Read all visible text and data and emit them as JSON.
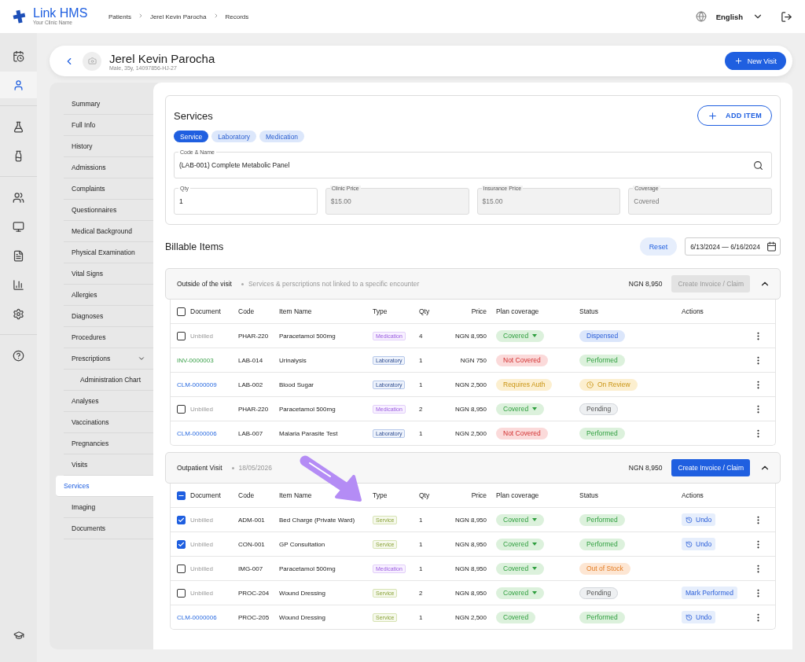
{
  "brand": {
    "name": "Link HMS",
    "subtitle": "Your Clinic Name"
  },
  "breadcrumbs": [
    "Patients",
    "Jerel Kevin Parocha",
    "Records"
  ],
  "language": "English",
  "rail": [
    {
      "kind": "calendar",
      "selected": false
    },
    {
      "kind": "patient",
      "selected": true
    },
    {
      "kind": "lab",
      "selected": false
    },
    {
      "kind": "bottle",
      "selected": false
    },
    {
      "kind": "people",
      "selected": false
    },
    {
      "kind": "monitor",
      "selected": false
    },
    {
      "kind": "document",
      "selected": false
    },
    {
      "kind": "chart",
      "selected": false
    },
    {
      "kind": "settings",
      "selected": false
    },
    {
      "kind": "help",
      "selected": false
    }
  ],
  "rail_footer": {
    "kind": "learning"
  },
  "patient": {
    "name": "Jerel Kevin Parocha",
    "details": "Male, 35y, 14097856-HJ-27",
    "new_visit": "New Visit"
  },
  "nav": [
    {
      "label": "Summary",
      "selected": false
    },
    {
      "label": "Full Info",
      "selected": false
    },
    {
      "label": "History",
      "selected": false
    },
    {
      "label": "Admissions",
      "selected": false
    },
    {
      "label": "Complaints",
      "selected": false
    },
    {
      "label": "Questionnaires",
      "selected": false
    },
    {
      "label": "Medical Background",
      "selected": false
    },
    {
      "label": "Physical Examination",
      "selected": false
    },
    {
      "label": "Vital Signs",
      "selected": false
    },
    {
      "label": "Allergies",
      "selected": false
    },
    {
      "label": "Diagnoses",
      "selected": false
    },
    {
      "label": "Procedures",
      "selected": false
    },
    {
      "label": "Prescriptions",
      "selected": false,
      "expanded": true,
      "children": [
        {
          "label": "Administration Chart",
          "selected": false
        }
      ]
    },
    {
      "label": "Analyses",
      "selected": false
    },
    {
      "label": "Vaccinations",
      "selected": false
    },
    {
      "label": "Pregnancies",
      "selected": false
    },
    {
      "label": "Visits",
      "selected": false
    },
    {
      "label": "Services",
      "selected": true
    },
    {
      "label": "Imaging",
      "selected": false
    },
    {
      "label": "Documents",
      "selected": false
    }
  ],
  "services": {
    "title": "Services",
    "add_item": "ADD ITEM",
    "tabs": [
      {
        "label": "Service",
        "selected": true
      },
      {
        "label": "Laboratory",
        "selected": false
      },
      {
        "label": "Medication",
        "selected": false
      }
    ],
    "code_field": {
      "label": "Code & Name",
      "value": "(LAB-001) Complete Metabolic Panel"
    },
    "fields": [
      {
        "label": "Qty",
        "value": "1",
        "disabled": false
      },
      {
        "label": "Clinic Price",
        "value": "$15.00",
        "disabled": true
      },
      {
        "label": "Insurance Price",
        "value": "$15.00",
        "disabled": true
      },
      {
        "label": "Coverage",
        "value": "Covered",
        "disabled": true
      }
    ]
  },
  "billable": {
    "title": "Billable Items",
    "reset": "Reset",
    "date_range": "6/13/2024 — 6/16/2024"
  },
  "groups": [
    {
      "title": "Outside of the visit",
      "subtitle": "Services & perscriptions not linked to a specific encounter",
      "total": "NGN 8,950",
      "invoice_button": "Create Invoice / Claim",
      "invoice_disabled": true,
      "expanded": true,
      "header_indeterminate": false,
      "columns": [
        "Document",
        "Code",
        "Item Name",
        "Type",
        "Qty",
        "Price",
        "Plan coverage",
        "Status",
        "Actions"
      ],
      "rows": [
        {
          "document": {
            "kind": "checkbox",
            "checked": false,
            "label": "Unbilled"
          },
          "code": "PHAR-220",
          "name": "Paracetamol 500mg",
          "type": {
            "label": "Medication",
            "kind": "medication"
          },
          "qty": "4",
          "price": "NGN 8,950",
          "coverage": {
            "label": "Covered",
            "kind": "covered",
            "dropdown": true
          },
          "status": {
            "label": "Dispensed",
            "kind": "dispensed"
          }
        },
        {
          "document": {
            "kind": "invoice",
            "label": "INV-0000003"
          },
          "code": "LAB-014",
          "name": "Urinalysis",
          "type": {
            "label": "Laboratory",
            "kind": "laboratory"
          },
          "qty": "1",
          "price": "NGN 750",
          "coverage": {
            "label": "Not Covered",
            "kind": "not_covered",
            "dropdown": false
          },
          "status": {
            "label": "Performed",
            "kind": "performed"
          }
        },
        {
          "document": {
            "kind": "claim",
            "label": "CLM-0000009"
          },
          "code": "LAB-002",
          "name": "Blood Sugar",
          "type": {
            "label": "Laboratory",
            "kind": "laboratory"
          },
          "qty": "1",
          "price": "NGN 2,500",
          "coverage": {
            "label": "Requires Auth",
            "kind": "requires_auth",
            "dropdown": false
          },
          "status": {
            "label": "On Review",
            "kind": "review"
          }
        },
        {
          "document": {
            "kind": "checkbox",
            "checked": false,
            "label": "Unbilled"
          },
          "code": "PHAR-220",
          "name": "Paracetamol 500mg",
          "type": {
            "label": "Medication",
            "kind": "medication"
          },
          "qty": "2",
          "price": "NGN 8,950",
          "coverage": {
            "label": "Covered",
            "kind": "covered",
            "dropdown": true
          },
          "status": {
            "label": "Pending",
            "kind": "pending"
          }
        },
        {
          "document": {
            "kind": "claim",
            "label": "CLM-0000006"
          },
          "code": "LAB-007",
          "name": "Malaria Parasite Test",
          "type": {
            "label": "Laboratory",
            "kind": "laboratory"
          },
          "qty": "1",
          "price": "NGN 2,500",
          "coverage": {
            "label": "Not Covered",
            "kind": "not_covered",
            "dropdown": false
          },
          "status": {
            "label": "Performed",
            "kind": "performed"
          }
        }
      ]
    },
    {
      "title": "Outpatient Visit",
      "subtitle": "18/05/2026",
      "total": "NGN 8,950",
      "invoice_button": "Create Invoice / Claim",
      "invoice_disabled": false,
      "expanded": true,
      "header_indeterminate": true,
      "columns": [
        "Document",
        "Code",
        "Item Name",
        "Type",
        "Qty",
        "Price",
        "Plan coverage",
        "Status",
        "Actions"
      ],
      "rows": [
        {
          "document": {
            "kind": "checkbox",
            "checked": true,
            "label": "Unbilled"
          },
          "code": "ADM-001",
          "name": "Bed Charge (Private Ward)",
          "type": {
            "label": "Service",
            "kind": "service"
          },
          "qty": "1",
          "price": "NGN 8,950",
          "coverage": {
            "label": "Covered",
            "kind": "covered",
            "dropdown": true
          },
          "status": {
            "label": "Performed",
            "kind": "performed"
          },
          "action": {
            "label": "Undo",
            "kind": "undo"
          }
        },
        {
          "document": {
            "kind": "checkbox",
            "checked": true,
            "label": "Unbilled"
          },
          "code": "CON-001",
          "name": "GP Consultation",
          "type": {
            "label": "Service",
            "kind": "service"
          },
          "qty": "1",
          "price": "NGN 8,950",
          "coverage": {
            "label": "Covered",
            "kind": "covered",
            "dropdown": true
          },
          "status": {
            "label": "Performed",
            "kind": "performed"
          },
          "action": {
            "label": "Undo",
            "kind": "undo"
          }
        },
        {
          "document": {
            "kind": "checkbox",
            "checked": false,
            "label": "Unbilled"
          },
          "code": "IMG-007",
          "name": "Paracetamol 500mg",
          "type": {
            "label": "Medication",
            "kind": "medication"
          },
          "qty": "1",
          "price": "NGN 8,950",
          "coverage": {
            "label": "Covered",
            "kind": "covered",
            "dropdown": true
          },
          "status": {
            "label": "Out of Stock",
            "kind": "out_of_stock"
          }
        },
        {
          "document": {
            "kind": "checkbox",
            "checked": false,
            "label": "Unbilled"
          },
          "code": "PROC-204",
          "name": "Wound Dressing",
          "type": {
            "label": "Service",
            "kind": "service"
          },
          "qty": "2",
          "price": "NGN 8,950",
          "coverage": {
            "label": "Covered",
            "kind": "covered",
            "dropdown": true
          },
          "status": {
            "label": "Pending",
            "kind": "pending"
          },
          "action": {
            "label": "Mark Performed",
            "kind": "mark"
          }
        },
        {
          "document": {
            "kind": "claim",
            "label": "CLM-0000006"
          },
          "code": "PROC-205",
          "name": "Wound Dressing",
          "type": {
            "label": "Service",
            "kind": "service"
          },
          "qty": "1",
          "price": "NGN 2,500",
          "coverage": {
            "label": "Covered",
            "kind": "covered",
            "dropdown": false
          },
          "status": {
            "label": "Performed",
            "kind": "performed"
          },
          "action": {
            "label": "Undo",
            "kind": "undo"
          }
        }
      ]
    }
  ]
}
